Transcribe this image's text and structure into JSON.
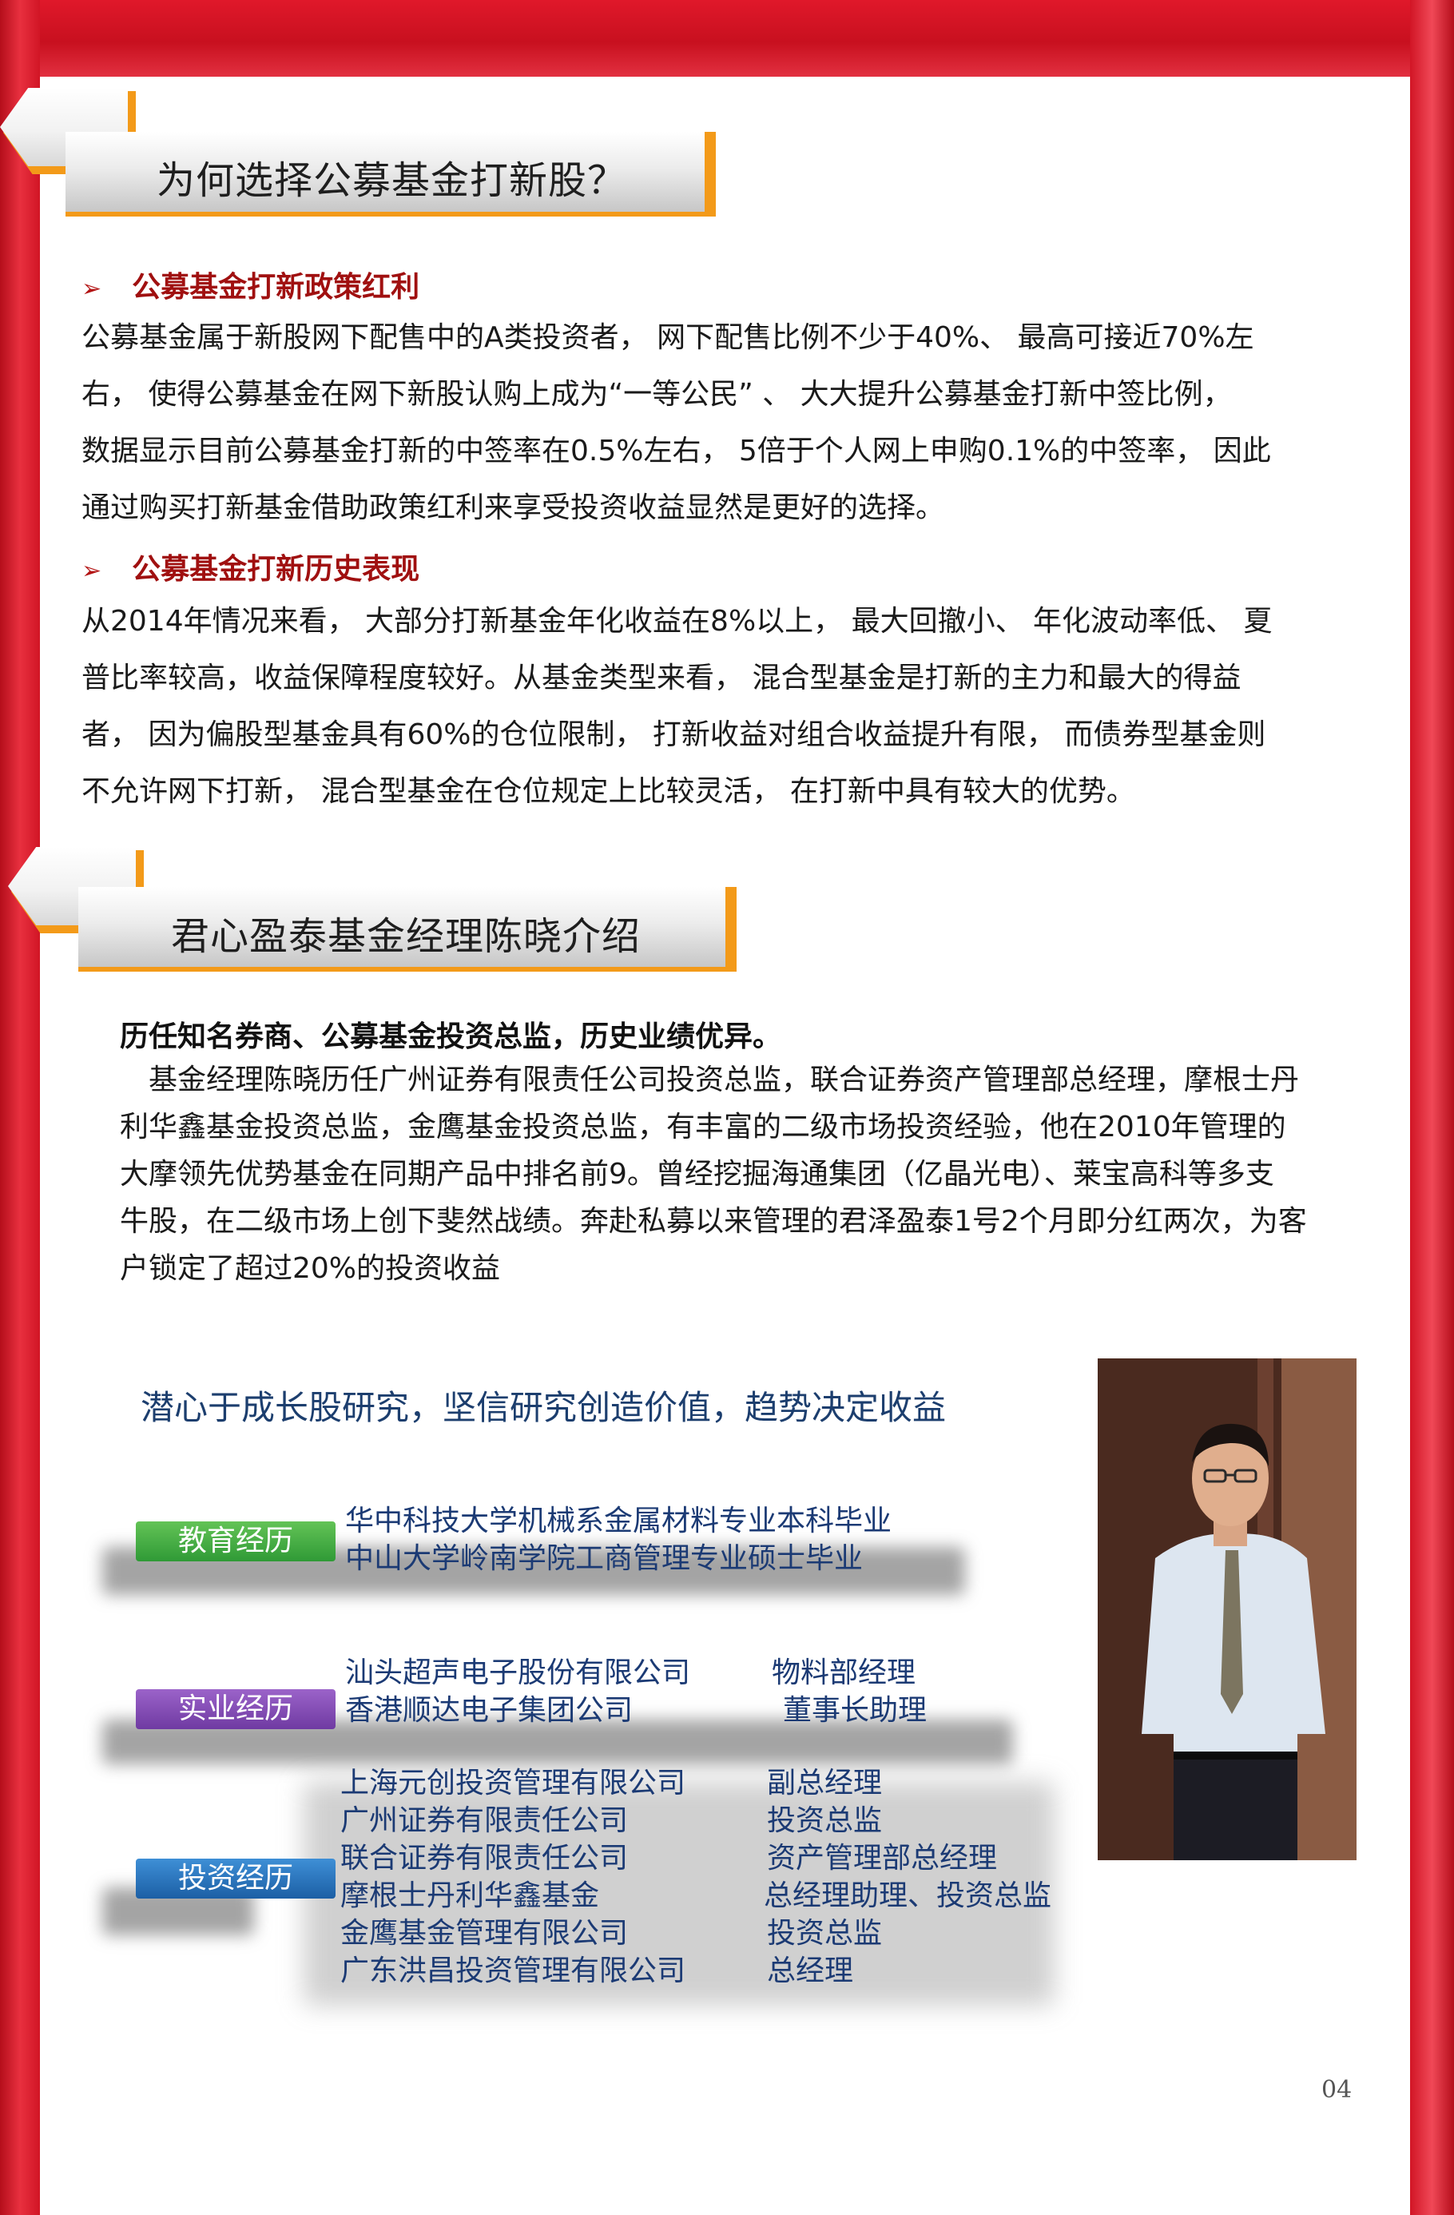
{
  "section1": {
    "title": "为何选择公募基金打新股？",
    "bullet1": {
      "heading": "公募基金打新政策红利",
      "lines": [
        "公募基金属于新股网下配售中的A类投资者， 网下配售比例不少于40%、 最高可接近70%左",
        "右， 使得公募基金在网下新股认购上成为“一等公民” 、 大大提升公募基金打新中签比例，",
        "数据显示目前公募基金打新的中签率在0.5%左右， 5倍于个人网上申购0.1%的中签率， 因此",
        "通过购买打新基金借助政策红利来享受投资收益显然是更好的选择。"
      ]
    },
    "bullet2": {
      "heading": "公募基金打新历史表现",
      "lines": [
        "从2014年情况来看， 大部分打新基金年化收益在8%以上， 最大回撤小、 年化波动率低、 夏",
        "普比率较高，收益保障程度较好。从基金类型来看， 混合型基金是打新的主力和最大的得益",
        "者， 因为偏股型基金具有60%的仓位限制， 打新收益对组合收益提升有限， 而债券型基金则",
        "不允许网下打新， 混合型基金在仓位规定上比较灵活， 在打新中具有较大的优势。"
      ]
    }
  },
  "section2": {
    "title": "君心盈泰基金经理陈晓介绍",
    "bio_heading": "历任知名券商、公募基金投资总监，历史业绩优异。",
    "bio_lines": [
      "　基金经理陈晓历任广州证券有限责任公司投资总监，联合证券资产管理部总经理，摩根士丹",
      "利华鑫基金投资总监，金鹰基金投资总监，有丰富的二级市场投资经验，他在2010年管理的",
      "大摩领先优势基金在同期产品中排名前9。曾经挖掘海通集团（亿晶光电）、莱宝高科等多支",
      "牛股，在二级市场上创下斐然战绩。奔赴私募以来管理的君泽盈泰1号2个月即分红两次，为客",
      "户锁定了超过20%的投资收益"
    ],
    "slogan": "潜心于成长股研究，坚信研究创造价值，趋势决定收益",
    "education": {
      "label": "教育经历",
      "items": [
        "华中科技大学机械系金属材料专业本科毕业",
        "中山大学岭南学院工商管理专业硕士毕业"
      ]
    },
    "industry": {
      "label": "实业经历",
      "items": [
        {
          "company": "汕头超声电子股份有限公司",
          "role": "物料部经理"
        },
        {
          "company": "香港顺达电子集团公司",
          "role": "董事长助理"
        }
      ]
    },
    "investment": {
      "label": "投资经历",
      "items": [
        {
          "company": "上海元创投资管理有限公司",
          "role": "副总经理"
        },
        {
          "company": "广州证券有限责任公司",
          "role": "投资总监"
        },
        {
          "company": "联合证券有限责任公司",
          "role": "资产管理部总经理"
        },
        {
          "company": "摩根士丹利华鑫基金",
          "role": "总经理助理、投资总监"
        },
        {
          "company": "金鹰基金管理有限公司",
          "role": "投资总监"
        },
        {
          "company": "广东洪昌投资管理有限公司",
          "role": "总经理"
        }
      ]
    }
  },
  "page_number": "04"
}
